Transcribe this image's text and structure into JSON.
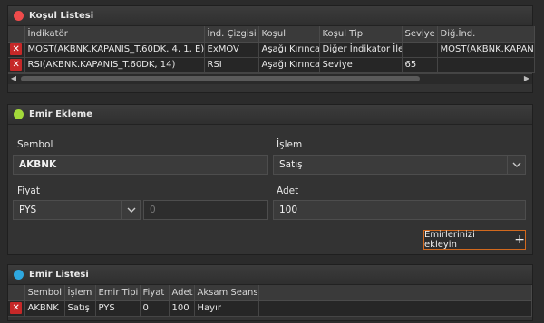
{
  "colors": {
    "red_dot": "#ef4b4b",
    "green_dot": "#a3d93a",
    "blue_dot": "#2ea8e0",
    "accent_orange": "#d2691e"
  },
  "condition_panel": {
    "title": "Koşul Listesi",
    "columns": [
      "İndikatör",
      "İnd. Çizgisi",
      "Koşul",
      "Koşul Tipi",
      "Seviye",
      "Diğ.İnd."
    ],
    "rows": [
      [
        "MOST(AKBNK.KAPANIS_T.60DK, 4, 1, E)",
        "ExMOV",
        "Aşağı Kırınca",
        "Diğer İndikator İle",
        "",
        "MOST(AKBNK.KAPANIS"
      ],
      [
        "RSI(AKBNK.KAPANIS_T.60DK, 14)",
        "RSI",
        "Aşağı Kırınca",
        "Seviye",
        "65",
        ""
      ]
    ]
  },
  "order_panel": {
    "title": "Emir Ekleme",
    "symbol_label": "Sembol",
    "symbol_value": "AKBNK",
    "action_label": "İşlem",
    "action_value": "Satış",
    "price_label": "Fiyat",
    "price_type_value": "PYS",
    "price_value": "0",
    "quantity_label": "Adet",
    "quantity_value": "100",
    "add_button_label": "Emirlerinizi ekleyin",
    "add_button_icon": "+"
  },
  "order_list_panel": {
    "title": "Emir Listesi",
    "columns": [
      "Sembol",
      "İşlem",
      "Emir Tipi",
      "Fiyat",
      "Adet",
      "Aksam Seansı"
    ],
    "rows": [
      [
        "AKBNK",
        "Satış",
        "PYS",
        "0",
        "100",
        "Hayır"
      ]
    ]
  }
}
